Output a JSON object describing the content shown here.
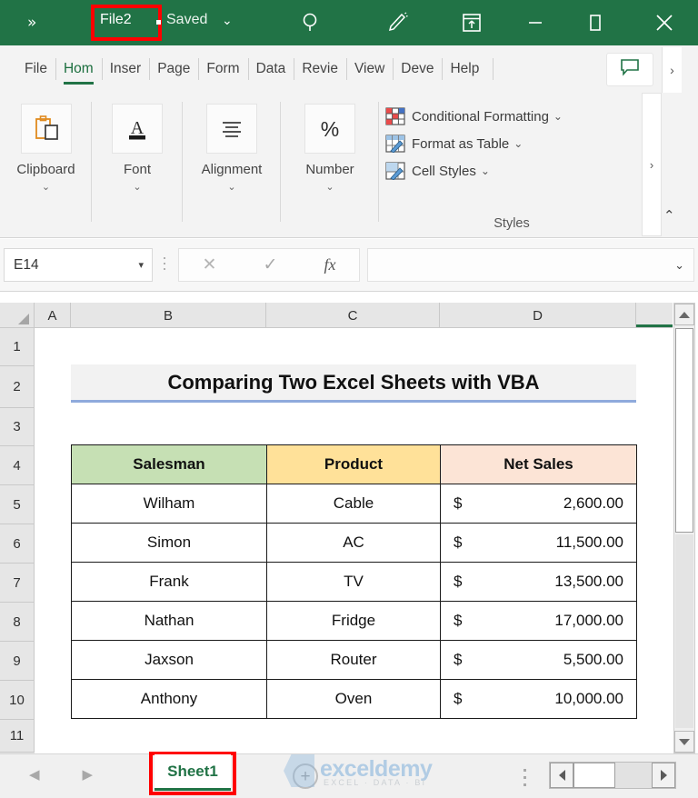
{
  "titlebar": {
    "overflow_chevrons": "»",
    "filename": "File2",
    "separator_dot": "",
    "saved_label": "Saved",
    "saved_chevron": "⌄",
    "icons": [
      "search-icon",
      "pen-icon",
      "share-icon",
      "minimize-icon",
      "maximize-icon",
      "close-icon"
    ],
    "highlight_color": "#ff0000",
    "background_color": "#217346"
  },
  "ribbon_tabs": [
    {
      "label": "File",
      "active": false
    },
    {
      "label": "Hom",
      "active": true
    },
    {
      "label": "Inser",
      "active": false
    },
    {
      "label": "Page",
      "active": false
    },
    {
      "label": "Form",
      "active": false
    },
    {
      "label": "Data",
      "active": false
    },
    {
      "label": "Revie",
      "active": false
    },
    {
      "label": "View",
      "active": false
    },
    {
      "label": "Deve",
      "active": false
    },
    {
      "label": "Help",
      "active": false
    }
  ],
  "ribbon_more": "›",
  "ribbon": {
    "groups": [
      {
        "label": "Clipboard",
        "icon": "clipboard-icon",
        "chevron": "⌄"
      },
      {
        "label": "Font",
        "icon": "font-icon",
        "chevron": "⌄"
      },
      {
        "label": "Alignment",
        "icon": "alignment-icon",
        "chevron": "⌄"
      },
      {
        "label": "Number",
        "icon": "percent-icon",
        "chevron": "⌄"
      }
    ],
    "styles": {
      "title": "Styles",
      "items": [
        {
          "label": "Conditional Formatting",
          "chevron": "⌄",
          "icon": "conditional-formatting-icon"
        },
        {
          "label": "Format as Table",
          "chevron": "⌄",
          "icon": "format-as-table-icon"
        },
        {
          "label": "Cell Styles",
          "chevron": "⌄",
          "icon": "cell-styles-icon"
        }
      ],
      "scroll_more": "›"
    },
    "collapse_chevron": "⌃"
  },
  "formula_bar": {
    "name_box_value": "E14",
    "name_box_chevron": "▾",
    "cancel_icon": "✕",
    "confirm_icon": "✓",
    "function_icon": "fx",
    "formula_value": "",
    "expand_chevron": "⌄"
  },
  "grid": {
    "column_headers": [
      "A",
      "B",
      "C",
      "D"
    ],
    "row_headers": [
      "1",
      "2",
      "3",
      "4",
      "5",
      "6",
      "7",
      "8",
      "9",
      "10",
      "11"
    ],
    "sheet_title": "Comparing Two Excel Sheets with VBA",
    "table": {
      "headers": [
        "Salesman",
        "Product",
        "Net Sales"
      ],
      "header_colors": [
        "#c6e0b4",
        "#ffe199",
        "#fce4d6"
      ],
      "currency_symbol": "$",
      "rows": [
        {
          "salesman": "Wilham",
          "product": "Cable",
          "net_sales": "2,600.00"
        },
        {
          "salesman": "Simon",
          "product": "AC",
          "net_sales": "11,500.00"
        },
        {
          "salesman": "Frank",
          "product": "TV",
          "net_sales": "13,500.00"
        },
        {
          "salesman": "Nathan",
          "product": "Fridge",
          "net_sales": "17,000.00"
        },
        {
          "salesman": "Jaxson",
          "product": "Router",
          "net_sales": "5,500.00"
        },
        {
          "salesman": "Anthony",
          "product": "Oven",
          "net_sales": "10,000.00"
        }
      ]
    }
  },
  "sheet_bar": {
    "prev_arrow": "◀",
    "next_arrow": "▶",
    "tabs": [
      {
        "label": "Sheet1",
        "active": true
      }
    ],
    "add_sheet_icon": "+",
    "highlight_color": "#ff0000"
  },
  "watermark": {
    "main": "exceldemy",
    "tagline": "EXCEL · DATA · BI"
  }
}
